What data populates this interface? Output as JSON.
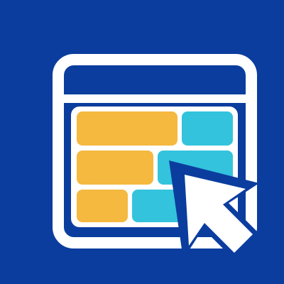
{
  "icon": {
    "name": "web-table-selection-icon",
    "colors": {
      "background": "#0b3d9e",
      "outline": "#ffffff",
      "address_bar": "#0b3d9e",
      "cell_yellow": "#f5b940",
      "cell_cyan": "#33c3dd",
      "cursor": "#ffffff"
    }
  }
}
